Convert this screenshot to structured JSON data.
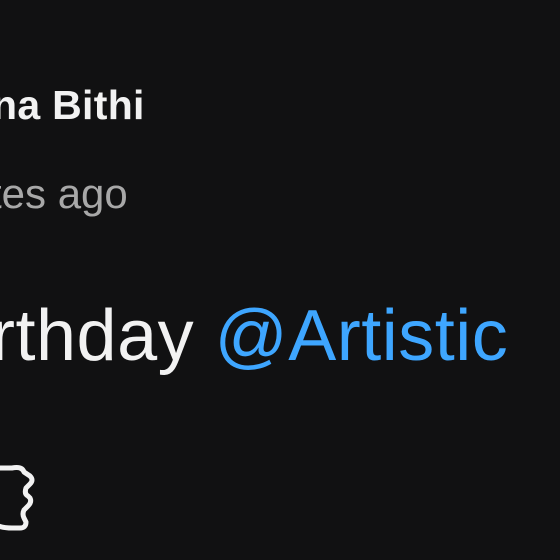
{
  "comment": {
    "author": "na Bithi",
    "timestamp": "tes ago",
    "text_prefix": "rthday ",
    "mention": "@Artistic"
  },
  "icons": {
    "like": "thumbs-up-icon"
  },
  "colors": {
    "background": "#111112",
    "text": "#f2f2f2",
    "secondary_text": "#a8a8a8",
    "mention": "#3ea6ff"
  }
}
